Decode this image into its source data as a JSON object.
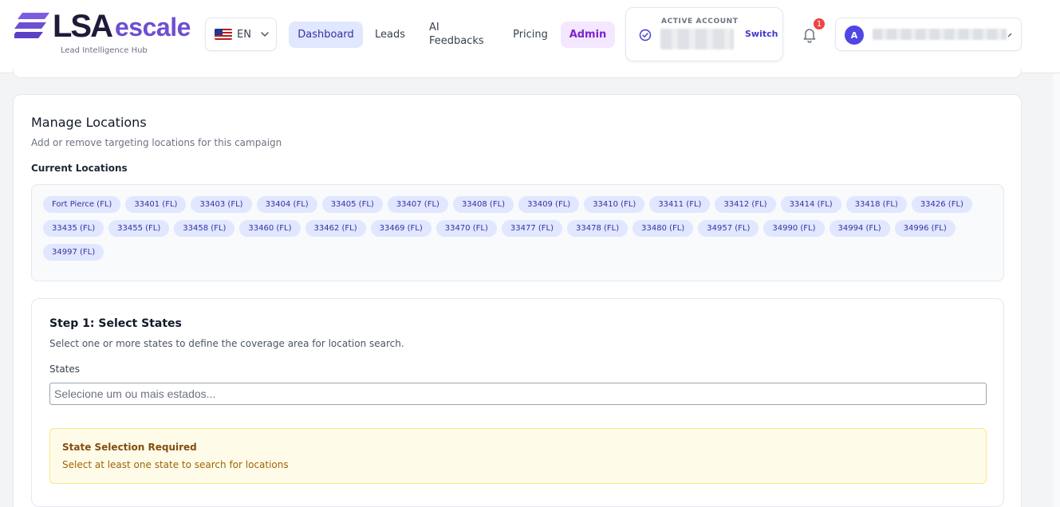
{
  "brand": {
    "name_part1": "LSA",
    "name_part2": "escale",
    "tagline": "Lead Intelligence Hub",
    "accent_color": "#6d4fd1"
  },
  "language": {
    "code": "EN",
    "flag_icon": "us-flag-icon"
  },
  "nav": {
    "dashboard": "Dashboard",
    "leads": "Leads",
    "ai_feedbacks": "AI Feedbacks",
    "pricing": "Pricing",
    "admin": "Admin"
  },
  "account": {
    "label": "ACTIVE ACCOUNT",
    "switch_label": "Switch"
  },
  "notifications": {
    "count": "1"
  },
  "user": {
    "avatar_initial": "A"
  },
  "manage_locations": {
    "title": "Manage Locations",
    "description": "Add or remove targeting locations for this campaign",
    "current_label": "Current Locations",
    "locations": [
      "Fort Pierce (FL)",
      "33401 (FL)",
      "33403 (FL)",
      "33404 (FL)",
      "33405 (FL)",
      "33407 (FL)",
      "33408 (FL)",
      "33409 (FL)",
      "33410 (FL)",
      "33411 (FL)",
      "33412 (FL)",
      "33414 (FL)",
      "33418 (FL)",
      "33426 (FL)",
      "33435 (FL)",
      "33455 (FL)",
      "33458 (FL)",
      "33460 (FL)",
      "33462 (FL)",
      "33469 (FL)",
      "33470 (FL)",
      "33477 (FL)",
      "33478 (FL)",
      "33480 (FL)",
      "34957 (FL)",
      "34990 (FL)",
      "34994 (FL)",
      "34996 (FL)",
      "34997 (FL)"
    ]
  },
  "step1": {
    "title": "Step 1: Select States",
    "description": "Select one or more states to define the coverage area for location search.",
    "states_label": "States",
    "states_value": "",
    "states_placeholder": "Selecione um ou mais estados...",
    "alert_title": "State Selection Required",
    "alert_text": "Select at least one state to search for locations"
  }
}
